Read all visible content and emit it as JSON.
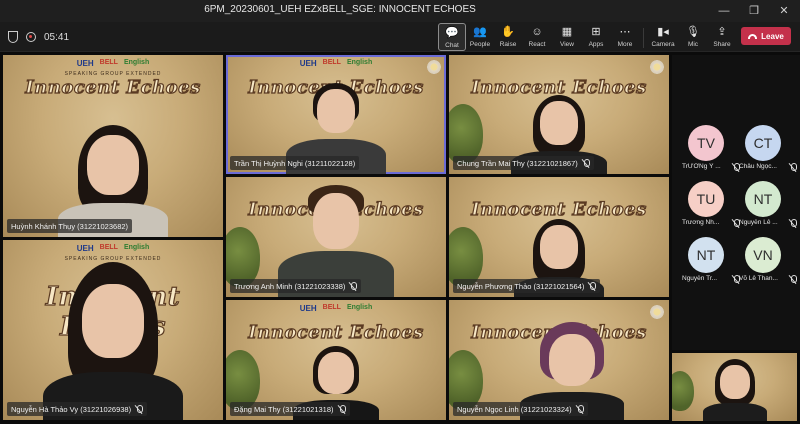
{
  "window": {
    "title": "6PM_20230601_UEH EZxBELL_SGE: INNOCENT ECHOES",
    "controls": [
      "—",
      "❐",
      "✕"
    ]
  },
  "toolbar": {
    "timer": "05:41",
    "buttons": [
      {
        "label": "Chat",
        "icon": "chat-icon",
        "glyph": "💬"
      },
      {
        "label": "People",
        "icon": "people-icon",
        "glyph": "👥"
      },
      {
        "label": "Raise",
        "icon": "raise-hand-icon",
        "glyph": "✋"
      },
      {
        "label": "React",
        "icon": "react-icon",
        "glyph": "☺"
      },
      {
        "label": "View",
        "icon": "view-icon",
        "glyph": "▦"
      },
      {
        "label": "Apps",
        "icon": "apps-icon",
        "glyph": "⊞"
      },
      {
        "label": "More",
        "icon": "more-icon",
        "glyph": "⋯"
      },
      {
        "label": "Camera",
        "icon": "camera-icon",
        "glyph": "▮◂"
      },
      {
        "label": "Mic",
        "icon": "mic-icon",
        "glyph": "🎙"
      },
      {
        "label": "Share",
        "icon": "share-icon",
        "glyph": "⇪"
      }
    ],
    "leave_label": "Leave"
  },
  "background": {
    "brand": "UEH",
    "brand2": "BELL",
    "brand3": "English",
    "subtitle": "SPEAKING GROUP EXTENDED",
    "banner": "Innocent Echoes"
  },
  "tiles": [
    {
      "name": "Huỳnh Khánh Thụy (31221023682)",
      "muted": false
    },
    {
      "name": "Trần Thị Huỳnh Nghi (31211022128)",
      "muted": false
    },
    {
      "name": "Chung Trần Mai Thy (31221021867)",
      "muted": true
    },
    {
      "name": "Nguyễn Hà Thảo Vy (31221026938)",
      "muted": true
    },
    {
      "name": "Trương Anh Minh (31221023338)",
      "muted": true
    },
    {
      "name": "Nguyễn Phương Thảo (31221021564)",
      "muted": true
    },
    {
      "name": "Đặng Mai Thy (31221021318)",
      "muted": true
    },
    {
      "name": "Nguyễn Ngọc Linh (31221023324)",
      "muted": true
    }
  ],
  "side_participants": [
    {
      "initials": "TV",
      "name": "TrƯƠNg Ý ...",
      "color": "#f3c6cf"
    },
    {
      "initials": "CT",
      "name": "Châu Ngọc...",
      "color": "#c6d7f0"
    },
    {
      "initials": "TU",
      "name": "Trương Nh...",
      "color": "#f6cfc6"
    },
    {
      "initials": "NT",
      "name": "Nguyễn Lê ...",
      "color": "#d3e9cf"
    },
    {
      "initials": "NT",
      "name": "Nguyễn Tr...",
      "color": "#d2e1ef"
    },
    {
      "initials": "VN",
      "name": "Võ Lê Than...",
      "color": "#dbecd2"
    }
  ]
}
